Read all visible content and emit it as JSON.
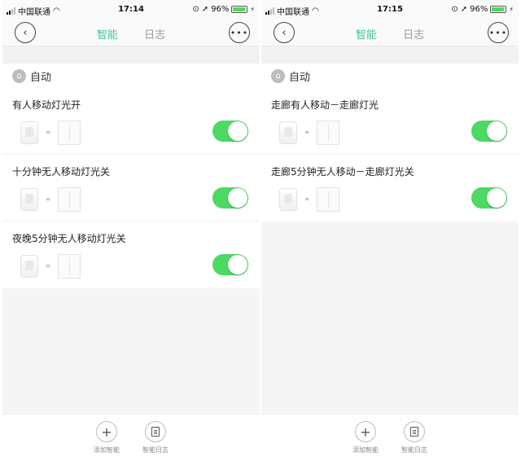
{
  "screens": [
    {
      "status": {
        "carrier": "中国联通",
        "time": "17:14",
        "battery": "96%"
      },
      "nav": {
        "back_icon": "back-arrow-icon",
        "tab_active": "智能",
        "tab_inactive": "日志",
        "more_icon": "more-icon"
      },
      "section_title": "自动",
      "items": [
        {
          "title": "有人移动灯光开",
          "enabled": true
        },
        {
          "title": "十分钟无人移动灯光关",
          "enabled": true
        },
        {
          "title": "夜晚5分钟无人移动灯光关",
          "enabled": true
        }
      ],
      "bottom": {
        "add_label": "添加智能",
        "log_label": "智能日志"
      }
    },
    {
      "status": {
        "carrier": "中国联通",
        "time": "17:15",
        "battery": "96%"
      },
      "nav": {
        "back_icon": "back-arrow-icon",
        "tab_active": "智能",
        "tab_inactive": "日志",
        "more_icon": "more-icon"
      },
      "section_title": "自动",
      "items": [
        {
          "title": "走廊有人移动－走廊灯光",
          "enabled": true
        },
        {
          "title": "走廊5分钟无人移动－走廊灯光关",
          "enabled": true
        }
      ],
      "bottom": {
        "add_label": "添加智能",
        "log_label": "智能日志"
      }
    }
  ],
  "colors": {
    "accent": "#3ec79d",
    "toggle_on": "#4cd964",
    "background": "#f5f5f5"
  }
}
